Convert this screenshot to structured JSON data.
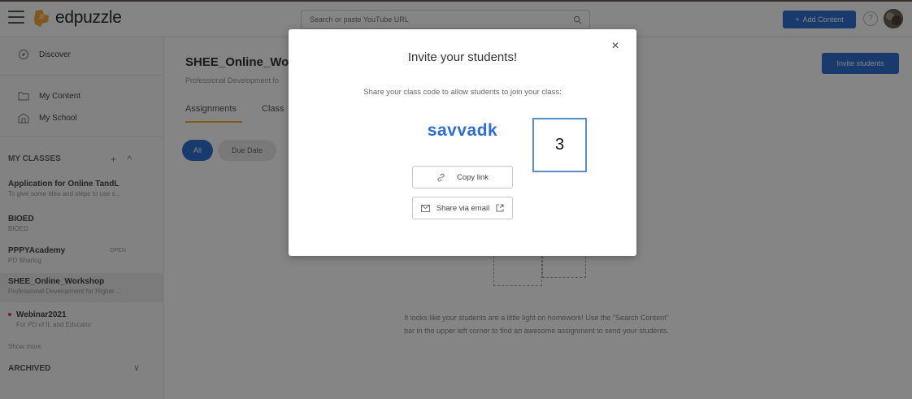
{
  "header": {
    "logo_text": "edpuzzle",
    "search_placeholder": "Search or paste YouTube URL",
    "add_content_label": "Add Content",
    "help_label": "?"
  },
  "sidebar": {
    "discover": "Discover",
    "my_content": "My Content",
    "my_school": "My School",
    "my_classes": "MY CLASSES",
    "classes": [
      {
        "name": "Application for Online TandL",
        "desc": "To give some idea and steps to use s..."
      },
      {
        "name": "BIOED",
        "desc": "BIOED"
      },
      {
        "name": "PPPYAcademy",
        "desc": "PD Sharing",
        "badge": "OPEN"
      },
      {
        "name": "SHEE_Online_Workshop",
        "desc": "Professional Development for Higher ..."
      },
      {
        "name": "Webinar2021",
        "desc": "For PD of IL and Educator"
      }
    ],
    "show_more": "Show more",
    "archived": "ARCHIVED"
  },
  "main": {
    "class_title": "SHEE_Online_Wor",
    "class_subtitle": "Professional Development fo",
    "tabs": [
      "Assignments",
      "Class"
    ],
    "invite_button": "Invite students",
    "filters": [
      "All",
      "Due Date"
    ],
    "empty_text_1": "It looks like your students are a little light on homework! Use the \"Search Content\"",
    "empty_text_2": "bar in the upper left corner to find an awesome assignment to send your students."
  },
  "modal": {
    "title": "Invite your students!",
    "description": "Share your class code to allow students to join your class:",
    "class_code": "savvadk",
    "copy_link": "Copy link",
    "share_email": "Share via email",
    "close": "×"
  },
  "annotation": {
    "label": "3"
  },
  "colors": {
    "accent": "#2f6fd1",
    "tab_underline": "#f2b12e",
    "annotation_border": "#5b8ec9"
  }
}
